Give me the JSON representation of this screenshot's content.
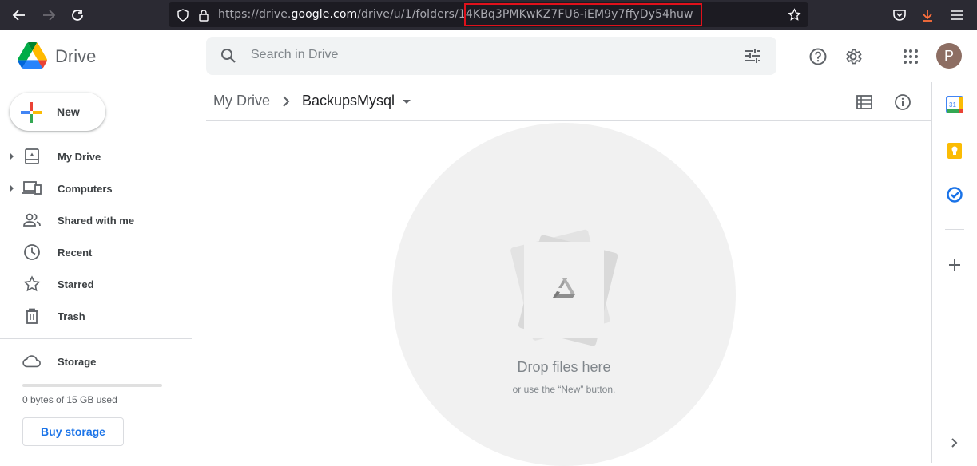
{
  "browser": {
    "url_prefix": "https://drive.",
    "url_host": "google.com",
    "url_path": "/drive/u/1/folders/",
    "url_id": "14KBq3PMKwKZ7FU6-iEM9y7ffyDy54huw"
  },
  "header": {
    "app_name": "Drive",
    "search_placeholder": "Search in Drive",
    "avatar_letter": "P"
  },
  "sidebar": {
    "new_label": "New",
    "items": [
      {
        "label": "My Drive",
        "icon": "my-drive-icon"
      },
      {
        "label": "Computers",
        "icon": "computers-icon"
      },
      {
        "label": "Shared with me",
        "icon": "people-icon"
      },
      {
        "label": "Recent",
        "icon": "clock-icon"
      },
      {
        "label": "Starred",
        "icon": "star-icon"
      },
      {
        "label": "Trash",
        "icon": "trash-icon"
      }
    ],
    "storage_label": "Storage",
    "storage_used": "0 bytes of 15 GB used",
    "storage_fraction": 0,
    "buy_storage": "Buy storage"
  },
  "breadcrumb": {
    "root": "My Drive",
    "current": "BackupsMysql"
  },
  "empty_state": {
    "title": "Drop files here",
    "subtitle": "or use the “New” button."
  },
  "side_panel": {
    "calendar_day": "31"
  },
  "colors": {
    "accent": "#1a73e8",
    "highlight": "#e0111b"
  }
}
